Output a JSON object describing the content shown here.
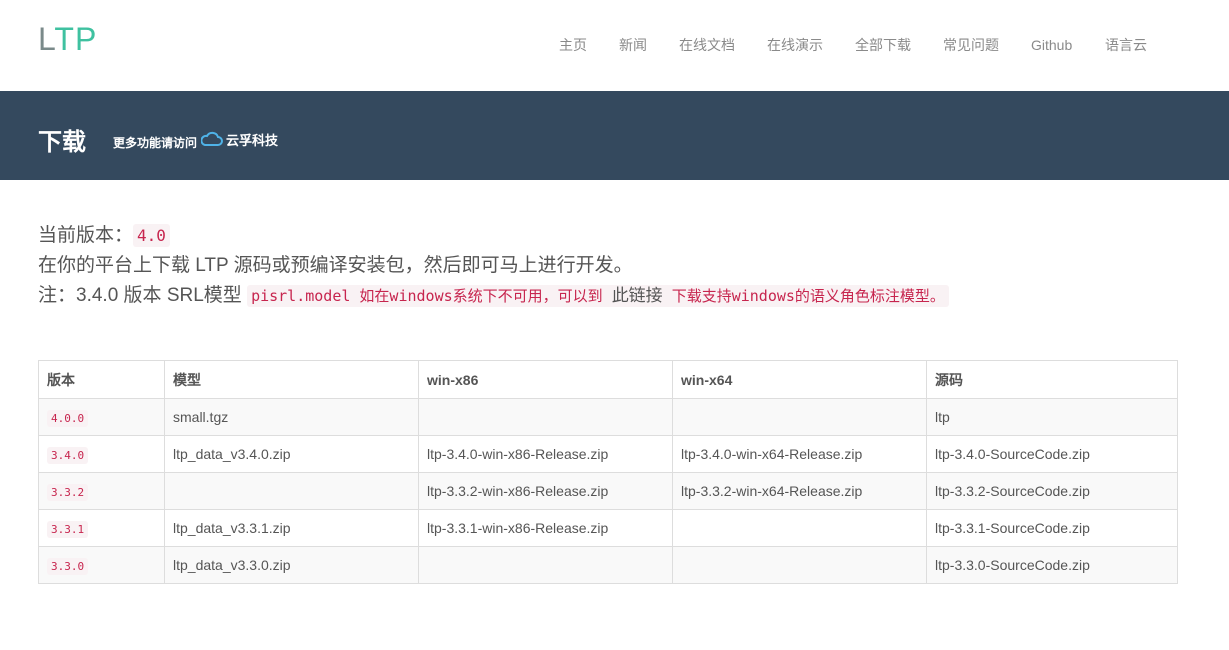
{
  "logo": {
    "part1": "L",
    "part2": "TP"
  },
  "nav": {
    "items": [
      {
        "label": "主页"
      },
      {
        "label": "新闻"
      },
      {
        "label": "在线文档"
      },
      {
        "label": "在线演示"
      },
      {
        "label": "全部下载"
      },
      {
        "label": "常见问题"
      },
      {
        "label": "Github"
      },
      {
        "label": "语言云"
      }
    ]
  },
  "banner": {
    "title": "下载",
    "more_text": "更多功能请访问",
    "brand_name": "云孚科技",
    "brand_icon": "cloud-icon"
  },
  "intro": {
    "version_label": "当前版本：",
    "version_value": "4.0",
    "line2": "在你的平台上下载 LTP 源码或预编译安装包，然后即可马上进行开发。",
    "note_prefix": "注：3.4.0 版本 SRL模型",
    "note_code": "pisrl.model 如在windows系统下不可用，可以到",
    "note_link": "此链接",
    "note_code2": "下载支持windows的语义角色标注模型。"
  },
  "table": {
    "headers": [
      "版本",
      "模型",
      "win-x86",
      "win-x64",
      "源码"
    ],
    "rows": [
      {
        "version": "4.0.0",
        "model": "small.tgz",
        "x86": "",
        "x64": "",
        "source": "ltp"
      },
      {
        "version": "3.4.0",
        "model": "ltp_data_v3.4.0.zip",
        "x86": "ltp-3.4.0-win-x86-Release.zip",
        "x64": "ltp-3.4.0-win-x64-Release.zip",
        "source": "ltp-3.4.0-SourceCode.zip"
      },
      {
        "version": "3.3.2",
        "model": "",
        "x86": "ltp-3.3.2-win-x86-Release.zip",
        "x64": "ltp-3.3.2-win-x64-Release.zip",
        "source": "ltp-3.3.2-SourceCode.zip"
      },
      {
        "version": "3.3.1",
        "model": "ltp_data_v3.3.1.zip",
        "x86": "ltp-3.3.1-win-x86-Release.zip",
        "x64": "",
        "source": "ltp-3.3.1-SourceCode.zip"
      },
      {
        "version": "3.3.0",
        "model": "ltp_data_v3.3.0.zip",
        "x86": "",
        "x64": "",
        "source": "ltp-3.3.0-SourceCode.zip"
      }
    ]
  },
  "colors": {
    "banner_bg": "#34495e",
    "logo_accent": "#3fc1a0",
    "code_text": "#c7254e",
    "code_bg": "#f9f2f4",
    "brand_icon": "#4fb3e8"
  }
}
